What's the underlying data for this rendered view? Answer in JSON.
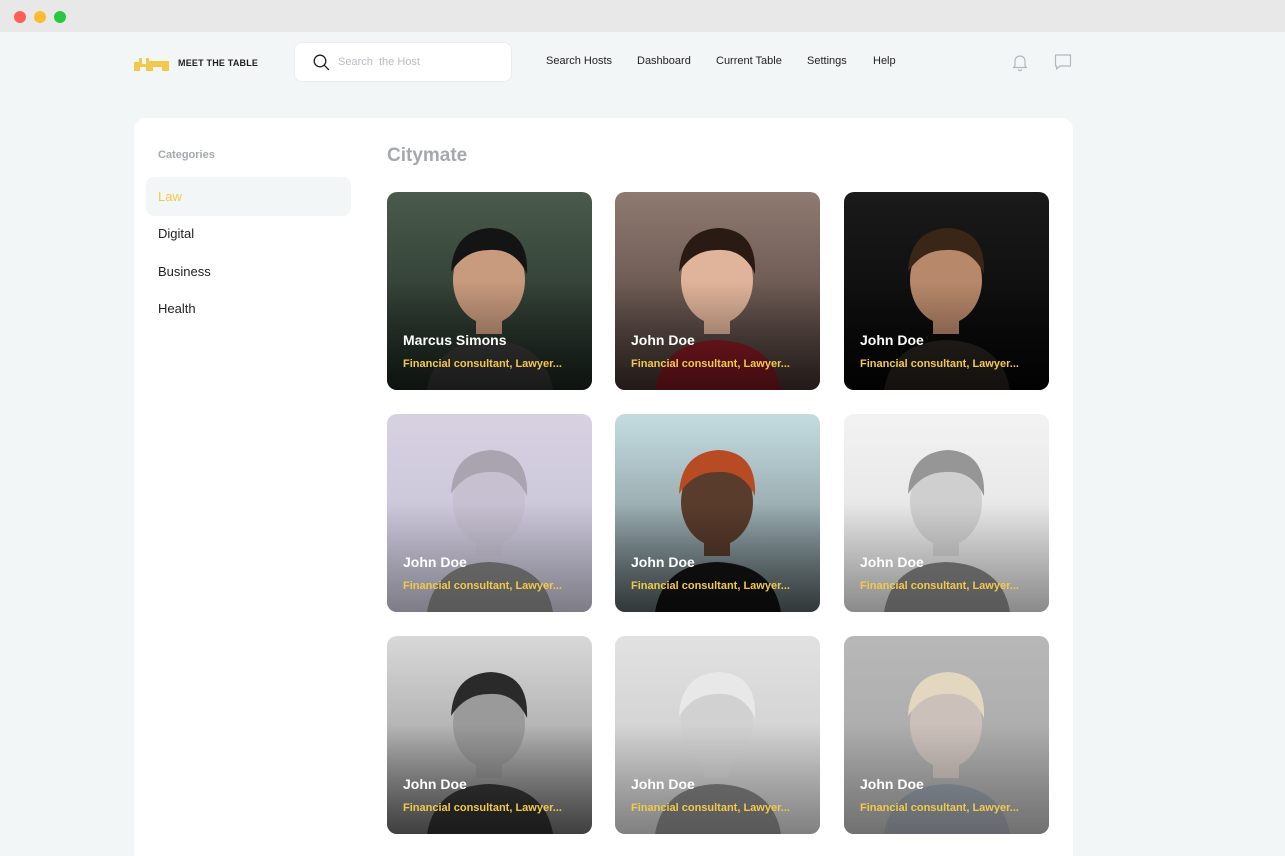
{
  "window": {
    "controls": [
      {
        "name": "close",
        "color": "#ff5f57"
      },
      {
        "name": "minimize",
        "color": "#febc2e"
      },
      {
        "name": "zoom",
        "color": "#28c840"
      }
    ]
  },
  "header": {
    "logo_text": "MEET THE TABLE",
    "logo_color": "#f2c94c",
    "search": {
      "placeholder": "Search  the Host",
      "value": "",
      "icon": "search-icon"
    },
    "nav": [
      "Search Hosts",
      "Dashboard",
      "Current Table",
      "Settings",
      "Help"
    ],
    "icons": [
      "bell-icon",
      "chat-icon"
    ]
  },
  "sidebar": {
    "heading": "Categories",
    "items": [
      {
        "label": "Law",
        "active": true
      },
      {
        "label": "Digital",
        "active": false
      },
      {
        "label": "Business",
        "active": false
      },
      {
        "label": "Health",
        "active": false
      }
    ]
  },
  "main": {
    "title": "Citymate",
    "hosts": [
      {
        "name": "Marcus Simons",
        "role": "Financial consultant, Lawyer...",
        "bg": [
          "#4a5a4c",
          "#1e2a22"
        ],
        "skin": "#c89a7e",
        "hair": "#141414",
        "faded": false
      },
      {
        "name": "John Doe",
        "role": "Financial consultant, Lawyer...",
        "bg": [
          "#8f7a70",
          "#4a3a36"
        ],
        "skin": "#e0b49a",
        "hair": "#2a1a14",
        "shirt": "#8a1a24",
        "faded": false
      },
      {
        "name": "John Doe",
        "role": "Financial consultant, Lawyer...",
        "bg": [
          "#1a1a1a",
          "#050505"
        ],
        "skin": "#b8886a",
        "hair": "#3a2616",
        "shirt": "#2a2420",
        "faded": false
      },
      {
        "name": "John Doe",
        "role": "Financial consultant, Lawyer...",
        "bg": [
          "#c8c0d6",
          "#a9a4c4"
        ],
        "skin": "#b0a8c0",
        "hair": "#8a8294",
        "faded": true
      },
      {
        "name": "John Doe",
        "role": "Financial consultant, Lawyer...",
        "bg": [
          "#c4dce0",
          "#6e7c80"
        ],
        "skin": "#5a3c2c",
        "hair": "#b84a24",
        "shirt": "#141414",
        "faded": false
      },
      {
        "name": "John Doe",
        "role": "Financial consultant, Lawyer...",
        "bg": [
          "#eeeeee",
          "#cfcfcf"
        ],
        "skin": "#bdbdbd",
        "hair": "#6e6e6e",
        "faded": true
      },
      {
        "name": "John Doe",
        "role": "Financial consultant, Lawyer...",
        "bg": [
          "#d8d8d8",
          "#8c8c8c"
        ],
        "skin": "#9a9a9a",
        "hair": "#2a2a2a",
        "faded": false
      },
      {
        "name": "John Doe",
        "role": "Financial consultant, Lawyer...",
        "bg": [
          "#d6d6d6",
          "#b0b0b0"
        ],
        "skin": "#c0c0c0",
        "hair": "#e0e0e0",
        "faded": true
      },
      {
        "name": "John Doe",
        "role": "Financial consultant, Lawyer...",
        "bg": [
          "#9c9c9c",
          "#808080"
        ],
        "skin": "#b8a8a0",
        "hair": "#d8c8a8",
        "shirt": "#5c6878",
        "faded": true
      }
    ]
  }
}
